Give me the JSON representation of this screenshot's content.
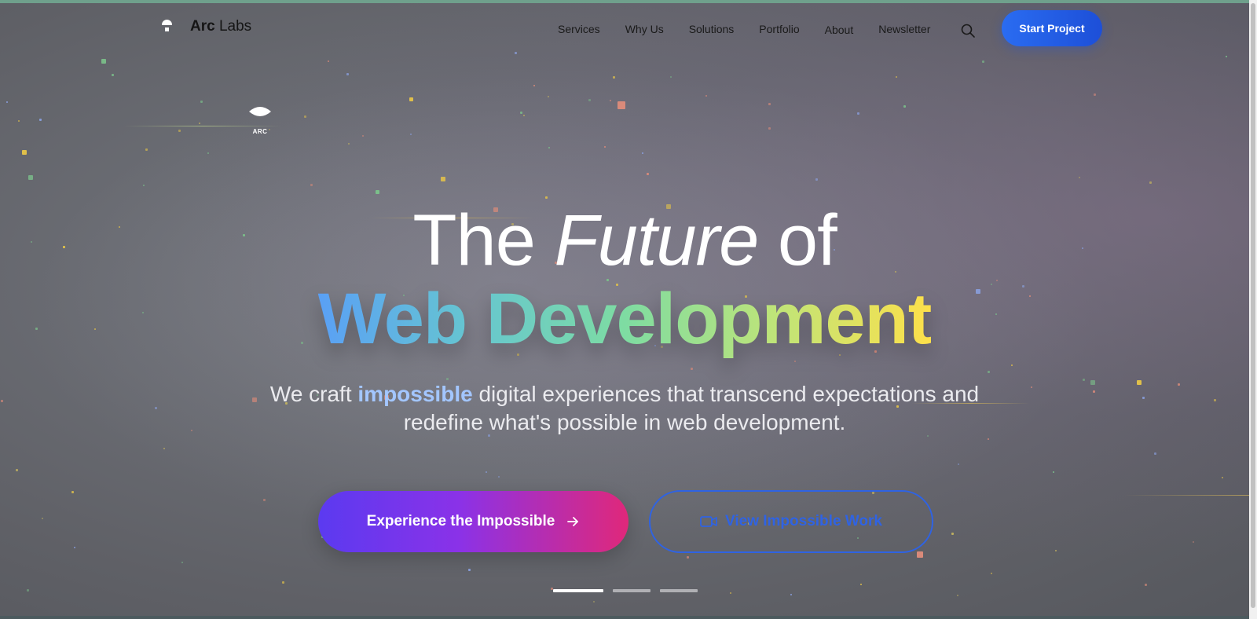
{
  "header": {
    "brand_bold": "Arc",
    "brand_light": "Labs",
    "nav": [
      "Services",
      "Why Us",
      "Solutions",
      "Portfolio",
      "About",
      "Newsletter"
    ],
    "cta_label": "Start Project"
  },
  "side_logo": {
    "label": "ARC"
  },
  "hero": {
    "line1_prefix": "The",
    "line1_em": "Future",
    "line1_suffix": "of",
    "line2": "Web Development",
    "sub_prefix": "We craft",
    "sub_highlight": "impossible",
    "sub_suffix": "digital experiences that transcend expectations and redefine what's possible in web development.",
    "primary_label": "Experience the Impossible",
    "secondary_label": "View Impossible Work"
  },
  "carousel": {
    "slides": 3,
    "active": 1
  },
  "colors": {
    "accent": "#2f63e3",
    "primary_gradient_start": "#5b3af0",
    "primary_gradient_end": "#e0287a",
    "highlight": "#a3c6ff"
  }
}
